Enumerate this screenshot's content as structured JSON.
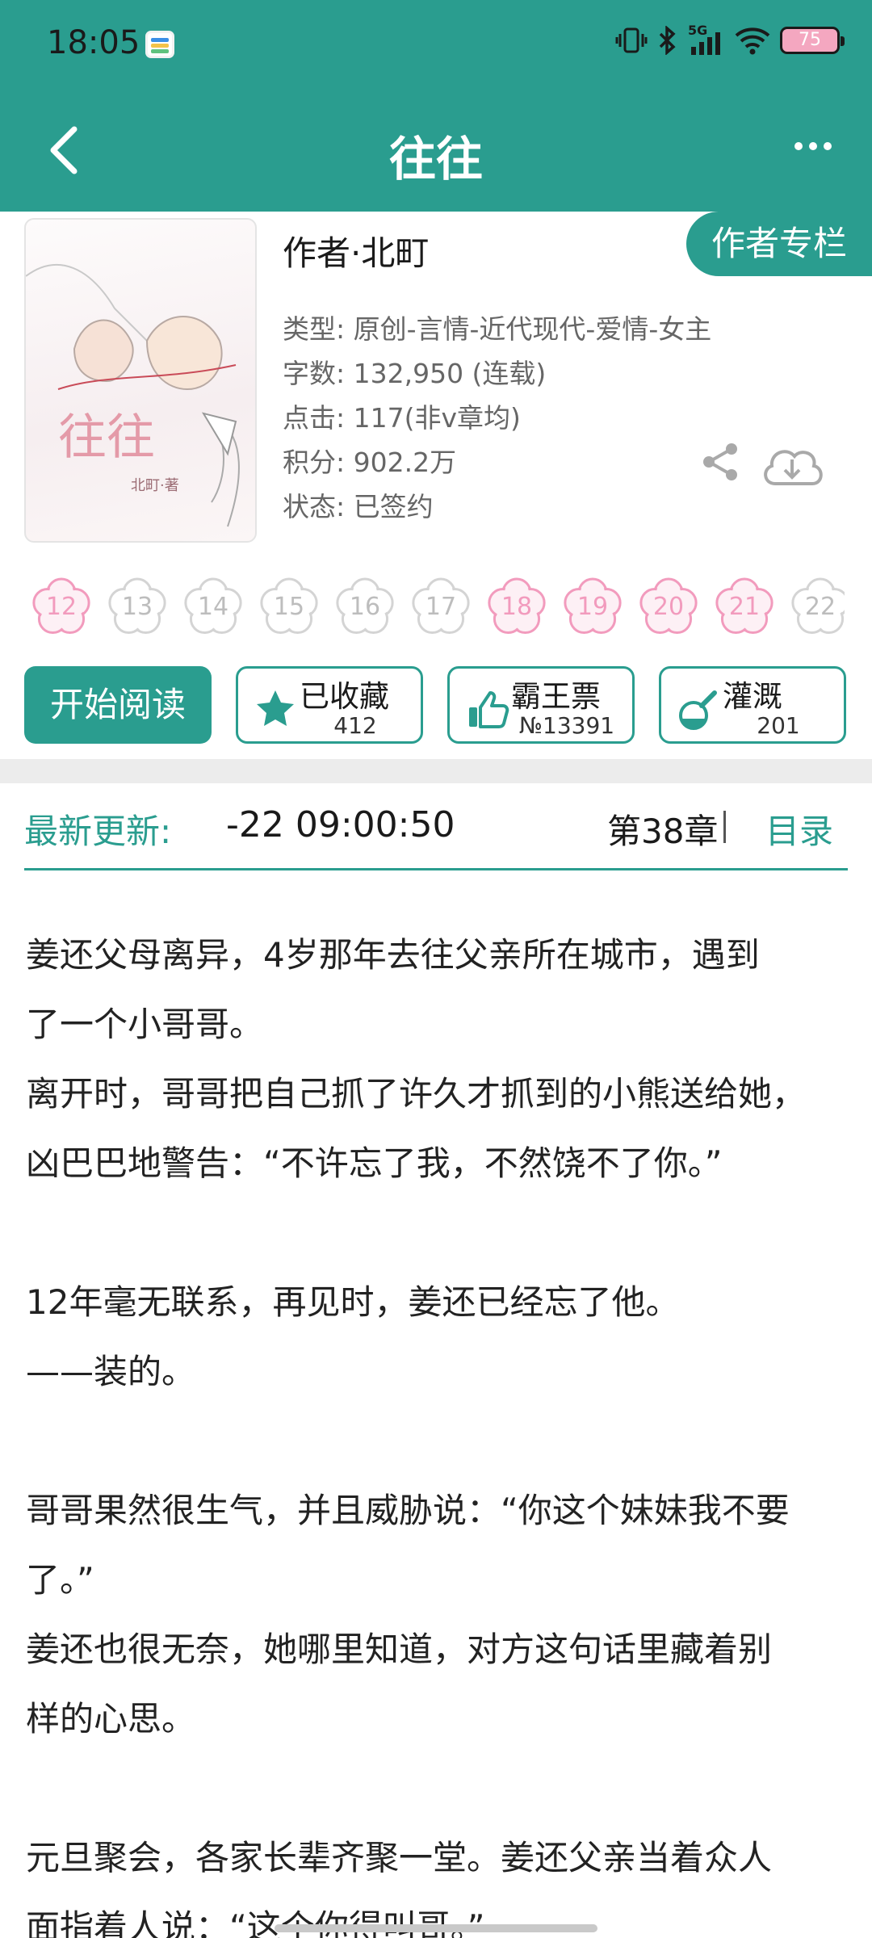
{
  "status_bar": {
    "time": "18:05",
    "network": "5G",
    "battery": "75"
  },
  "app_bar": {
    "title": "往往"
  },
  "book": {
    "author": "作者·北町",
    "author_column": "作者专栏",
    "cover_title": "往往",
    "cover_author": "北町·著",
    "meta": [
      "类型: 原创-言情-近代现代-爱情-女主",
      "字数: 132,950 (连载)",
      "点击: 117(非v章均)",
      "积分: 902.2万",
      "状态: 已签约"
    ]
  },
  "flowers": [
    {
      "label": "12",
      "active": true
    },
    {
      "label": "13",
      "active": false
    },
    {
      "label": "14",
      "active": false
    },
    {
      "label": "15",
      "active": false
    },
    {
      "label": "16",
      "active": false
    },
    {
      "label": "17",
      "active": false
    },
    {
      "label": "18",
      "active": true
    },
    {
      "label": "19",
      "active": true
    },
    {
      "label": "20",
      "active": true
    },
    {
      "label": "21",
      "active": true
    },
    {
      "label": "22",
      "active": false
    }
  ],
  "actions": {
    "read": "开始阅读",
    "collect": {
      "label": "已收藏",
      "count": "412"
    },
    "ticket": {
      "label": "霸王票",
      "count": "№13391"
    },
    "nutrient": {
      "label": "灌溉",
      "count": "201"
    }
  },
  "update": {
    "label": "最新更新:",
    "time": "-22 09:00:50",
    "chapter": "第38章",
    "toc": "目录"
  },
  "intro": [
    "姜还父母离异，4岁那年去往父亲所在城市，遇到",
    "了一个小哥哥。",
    "离开时，哥哥把自己抓了许久才抓到的小熊送给她，",
    "凶巴巴地警告：“不许忘了我，不然饶不了你。”",
    "",
    "12年毫无联系，再见时，姜还已经忘了他。",
    "——装的。",
    "",
    "哥哥果然很生气，并且威胁说：“你这个妹妹我不要",
    "了。”",
    "姜还也很无奈，她哪里知道，对方这句话里藏着别",
    "样的心思。",
    "",
    "元旦聚会，各家长辈齐聚一堂。姜还父亲当着众人",
    "面指着人说：“这个你得叫哥。”"
  ],
  "colors": {
    "primary": "#2a9d8f",
    "flower_active": "#f29bbd",
    "flower_inactive": "#d4d4d4"
  }
}
